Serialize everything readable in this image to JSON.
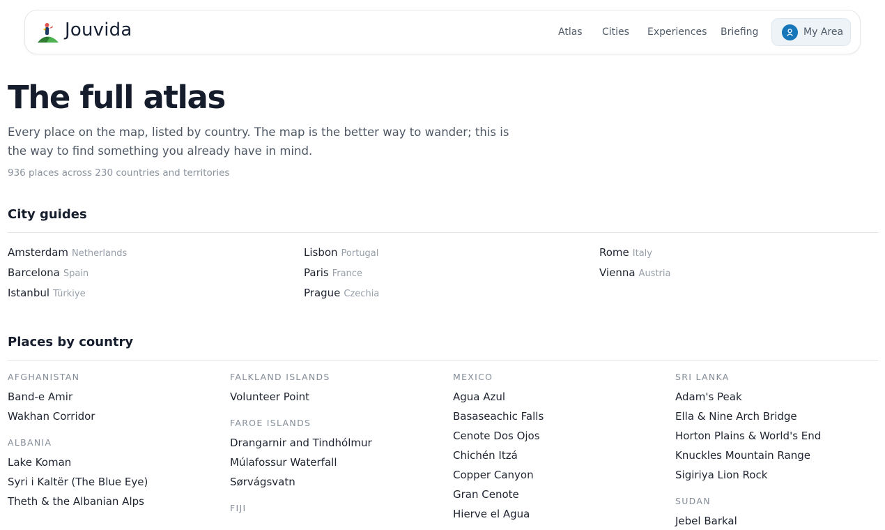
{
  "header": {
    "brand": "Jouvida",
    "nav": [
      "Atlas",
      "Cities",
      "Experiences",
      "Briefing"
    ],
    "my_area": "My Area"
  },
  "page": {
    "title": "The full atlas",
    "subtitle": "Every place on the map, listed by country. The map is the better way to wander; this is the way to find something you already have in mind.",
    "count": "936 places across 230 countries and territories"
  },
  "city_guides": {
    "title": "City guides",
    "items": [
      {
        "city": "Amsterdam",
        "country": "Netherlands"
      },
      {
        "city": "Barcelona",
        "country": "Spain"
      },
      {
        "city": "Istanbul",
        "country": "Türkiye"
      },
      {
        "city": "Lisbon",
        "country": "Portugal"
      },
      {
        "city": "Paris",
        "country": "France"
      },
      {
        "city": "Prague",
        "country": "Czechia"
      },
      {
        "city": "Rome",
        "country": "Italy"
      },
      {
        "city": "Vienna",
        "country": "Austria"
      }
    ]
  },
  "places_by_country": {
    "title": "Places by country",
    "columns": [
      [
        {
          "country": "AFGHANISTAN",
          "places": [
            "Band-e Amir",
            "Wakhan Corridor"
          ]
        },
        {
          "country": "ALBANIA",
          "places": [
            "Lake Koman",
            "Syri i Kaltër (The Blue Eye)",
            "Theth & the Albanian Alps"
          ]
        }
      ],
      [
        {
          "country": "FALKLAND ISLANDS",
          "places": [
            "Volunteer Point"
          ]
        },
        {
          "country": "FAROE ISLANDS",
          "places": [
            "Drangarnir and Tindhólmur",
            "Múlafossur Waterfall",
            "Sørvágsvatn"
          ]
        },
        {
          "country": "FIJI",
          "places": []
        }
      ],
      [
        {
          "country": "MEXICO",
          "places": [
            "Agua Azul",
            "Basaseachic Falls",
            "Cenote Dos Ojos",
            "Chichén Itzá",
            "Copper Canyon",
            "Gran Cenote",
            "Hierve el Agua"
          ]
        }
      ],
      [
        {
          "country": "SRI LANKA",
          "places": [
            "Adam's Peak",
            "Ella & Nine Arch Bridge",
            "Horton Plains & World's End",
            "Knuckles Mountain Range",
            "Sigiriya Lion Rock"
          ]
        },
        {
          "country": "SUDAN",
          "places": [
            "Jebel Barkal"
          ]
        }
      ]
    ]
  }
}
